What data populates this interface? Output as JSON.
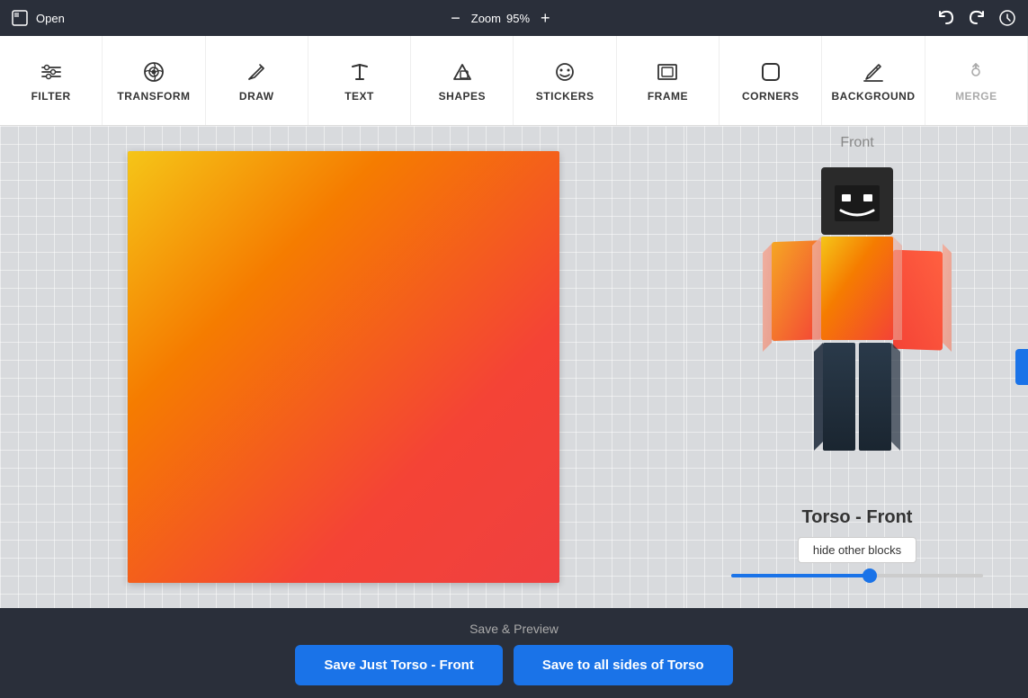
{
  "topbar": {
    "open_label": "Open",
    "zoom_label": "Zoom",
    "zoom_value": "95%",
    "zoom_minus": "−",
    "zoom_plus": "+"
  },
  "toolbar": {
    "items": [
      {
        "id": "filter",
        "label": "FILTER"
      },
      {
        "id": "transform",
        "label": "TRANSFORM"
      },
      {
        "id": "draw",
        "label": "DRAW"
      },
      {
        "id": "text",
        "label": "TEXT"
      },
      {
        "id": "shapes",
        "label": "SHAPES"
      },
      {
        "id": "stickers",
        "label": "STICKERS"
      },
      {
        "id": "frame",
        "label": "FRAME"
      },
      {
        "id": "corners",
        "label": "CORNERS"
      },
      {
        "id": "background",
        "label": "BACKGROUND"
      },
      {
        "id": "merge",
        "label": "MERGE",
        "disabled": true
      }
    ]
  },
  "preview": {
    "front_label": "Front",
    "torso_label": "Torso - Front",
    "hide_blocks_label": "hide other blocks"
  },
  "bottom": {
    "save_preview_label": "Save & Preview",
    "save_just_label": "Save Just Torso - Front",
    "save_all_label": "Save to all sides of Torso"
  }
}
